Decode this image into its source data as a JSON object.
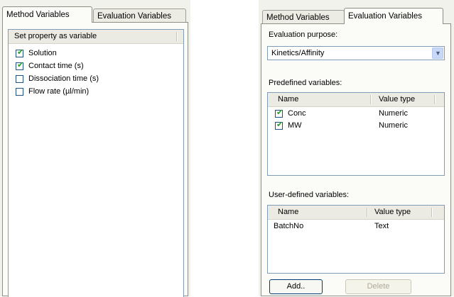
{
  "left_window": {
    "tabs": [
      "Method Variables",
      "Evaluation Variables"
    ],
    "active_tab": 0,
    "list_header": "Set property as variable",
    "items": [
      {
        "label": "Solution",
        "checked": true
      },
      {
        "label": "Contact time (s)",
        "checked": true
      },
      {
        "label": "Dissociation time (s)",
        "checked": false
      },
      {
        "label": "Flow rate (µl/min)",
        "checked": false
      }
    ]
  },
  "right_window": {
    "tabs": [
      "Method Variables",
      "Evaluation Variables"
    ],
    "active_tab": 1,
    "purpose_label": "Evaluation purpose:",
    "purpose_value": "Kinetics/Affinity",
    "predefined_label": "Predefined variables:",
    "predefined_columns": [
      "Name",
      "Value type"
    ],
    "predefined_rows": [
      {
        "name": "Conc",
        "type": "Numeric",
        "checked": true
      },
      {
        "name": "MW",
        "type": "Numeric",
        "checked": true
      }
    ],
    "userdefined_label": "User-defined variables:",
    "userdefined_columns": [
      "Name",
      "Value type"
    ],
    "userdefined_rows": [
      {
        "name": "BatchNo",
        "type": "Text"
      }
    ],
    "add_label": "Add..",
    "delete_label": "Delete"
  },
  "colors": {
    "check": "#21a121",
    "checkbox_border": "#1c5180",
    "list_border": "#7f9db9"
  },
  "icons": {
    "check": "check-icon",
    "dropdown": "chevron-down-icon"
  }
}
